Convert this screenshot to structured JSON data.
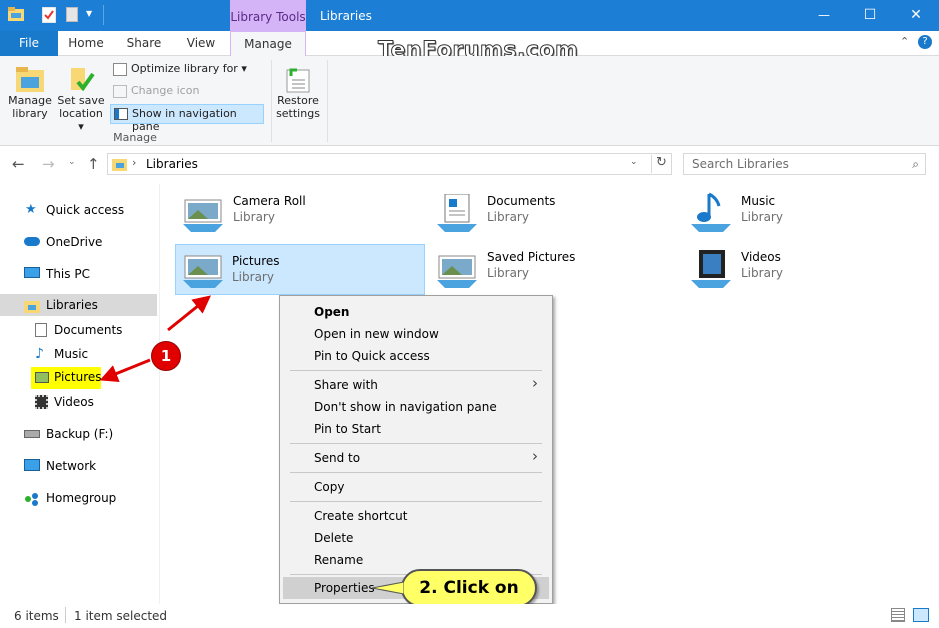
{
  "window": {
    "title": "Libraries",
    "contextual_tab_group": "Library Tools",
    "minimize_glyph": "—",
    "maximize_glyph": "☐",
    "close_glyph": "✕"
  },
  "ribbon_tabs": {
    "file": "File",
    "home": "Home",
    "share": "Share",
    "view": "View",
    "manage": "Manage"
  },
  "watermark": "TenForums.com",
  "ribbon": {
    "manage_library": [
      "Manage",
      "library"
    ],
    "set_save_location": [
      "Set save",
      "location ▾"
    ],
    "optimize_library": "Optimize library for ▾",
    "change_icon": "Change icon",
    "show_in_nav": "Show in navigation pane",
    "group_label": "Manage",
    "restore_settings": [
      "Restore",
      "settings"
    ]
  },
  "address": {
    "path": "Libraries",
    "search_placeholder": "Search Libraries"
  },
  "nav_pane": {
    "quick_access": "Quick access",
    "onedrive": "OneDrive",
    "this_pc": "This PC",
    "libraries": "Libraries",
    "documents": "Documents",
    "music": "Music",
    "pictures": "Pictures",
    "videos": "Videos",
    "backup": "Backup (F:)",
    "network": "Network",
    "homegroup": "Homegroup"
  },
  "libraries": [
    {
      "name": "Camera Roll",
      "type": "Library"
    },
    {
      "name": "Documents",
      "type": "Library"
    },
    {
      "name": "Music",
      "type": "Library"
    },
    {
      "name": "Pictures",
      "type": "Library"
    },
    {
      "name": "Saved Pictures",
      "type": "Library"
    },
    {
      "name": "Videos",
      "type": "Library"
    }
  ],
  "context_menu": {
    "open": "Open",
    "open_new_window": "Open in new window",
    "pin_quick_access": "Pin to Quick access",
    "share_with": "Share with",
    "dont_show": "Don't show in navigation pane",
    "pin_start": "Pin to Start",
    "send_to": "Send to",
    "copy": "Copy",
    "create_shortcut": "Create shortcut",
    "delete": "Delete",
    "rename": "Rename",
    "properties": "Properties"
  },
  "annotations": {
    "step1": "1",
    "step2": "2. Click on"
  },
  "status": {
    "items": "6 items",
    "selected": "1 item selected"
  },
  "colors": {
    "titlebar": "#1d7ed6",
    "selection": "#cce8ff",
    "highlight": "#ffff00",
    "callout": "#ffff66",
    "badge": "#e00000"
  }
}
